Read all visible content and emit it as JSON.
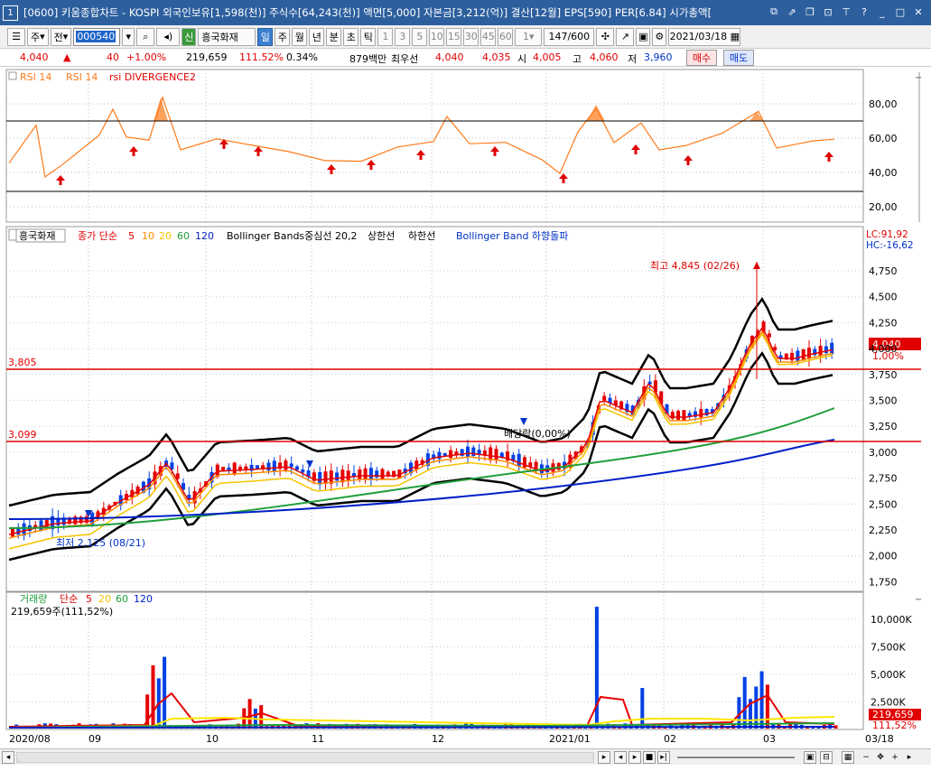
{
  "title_num": "1",
  "title": "[0600] 키움종합차트 - KOSPI 외국인보유[1,598(천)] 주식수[64,243(천)] 액면[5,000] 자본금[3,212(억)] 결산[12월] EPS[590] PER[6.84] 시가총액[",
  "toolbar": {
    "mode1": "주",
    "mode2": "전",
    "code": "000540",
    "name": "흥국화재",
    "name_badge": "신",
    "periods": [
      "일",
      "주",
      "월",
      "년",
      "분",
      "초",
      "틱"
    ],
    "minutes": [
      "1",
      "3",
      "5",
      "10",
      "15",
      "30",
      "45",
      "60"
    ],
    "unit": "1",
    "count": "147/600",
    "date": "2021/03/18"
  },
  "info": {
    "price": "4,040",
    "change": "40",
    "pct": "+1.00%",
    "volume": "219,659",
    "vol_ratio": "111.52%",
    "turnover": "0.34%",
    "amount": "879백만",
    "best": "최우선",
    "bid": "4,040",
    "ask": "4,035",
    "open_label": "시",
    "open": "4,005",
    "high_label": "고",
    "high": "4,060",
    "low_label": "저",
    "low": "3,960",
    "buy": "매수",
    "sell": "매도"
  },
  "rsi": {
    "legend": [
      "RSI 14",
      "RSI 14",
      "rsi DIVERGENCE2"
    ],
    "axis": [
      "80,00",
      "60,00",
      "40,00",
      "20,00"
    ]
  },
  "price": {
    "legend_name": "흥국화재",
    "legend_ma": "종가 단순",
    "periods": [
      "5",
      "10",
      "20",
      "60",
      "120"
    ],
    "bb": "Bollinger Bands중심선 20,2",
    "upper": "상한선",
    "lower": "하한선",
    "bbb": "Bollinger Band 하향돌파",
    "lc": "LC:91,92",
    "hc": "HC:-16,62",
    "hi_note": "최고 4,845 (02/26)",
    "lo_note": "최저 2,125 (08/21)",
    "div_note": "배당락(0,00%)",
    "level1": "3,805",
    "level2": "3,099",
    "cur_price": "4,040",
    "cur_pct": "1,00%",
    "axis": [
      "4,750",
      "4,500",
      "4,250",
      "4,000",
      "3,750",
      "3,500",
      "3,250",
      "3,000",
      "2,750",
      "2,500",
      "2,250",
      "2,000",
      "1,750"
    ]
  },
  "volume": {
    "legend_name": "거래량",
    "legend_ma": "단순",
    "periods": [
      "5",
      "20",
      "60",
      "120"
    ],
    "current": "219,659주(111,52%)",
    "axis": [
      "10,000K",
      "7,500K",
      "5,000K",
      "2,500K"
    ],
    "cur": "219,659",
    "cur_pct": "111,52%"
  },
  "xaxis": [
    "2020/08",
    "09",
    "10",
    "11",
    "12",
    "2021/01",
    "02",
    "03",
    "03/18"
  ],
  "colors": {
    "up": "#e60000",
    "down": "#0041e6",
    "ma5": "#e60000",
    "ma10": "#ff8c00",
    "ma20": "#f5c400",
    "ma60": "#1f9e3a",
    "ma120": "#0020c8",
    "rsi": "#ff7a1a"
  }
}
